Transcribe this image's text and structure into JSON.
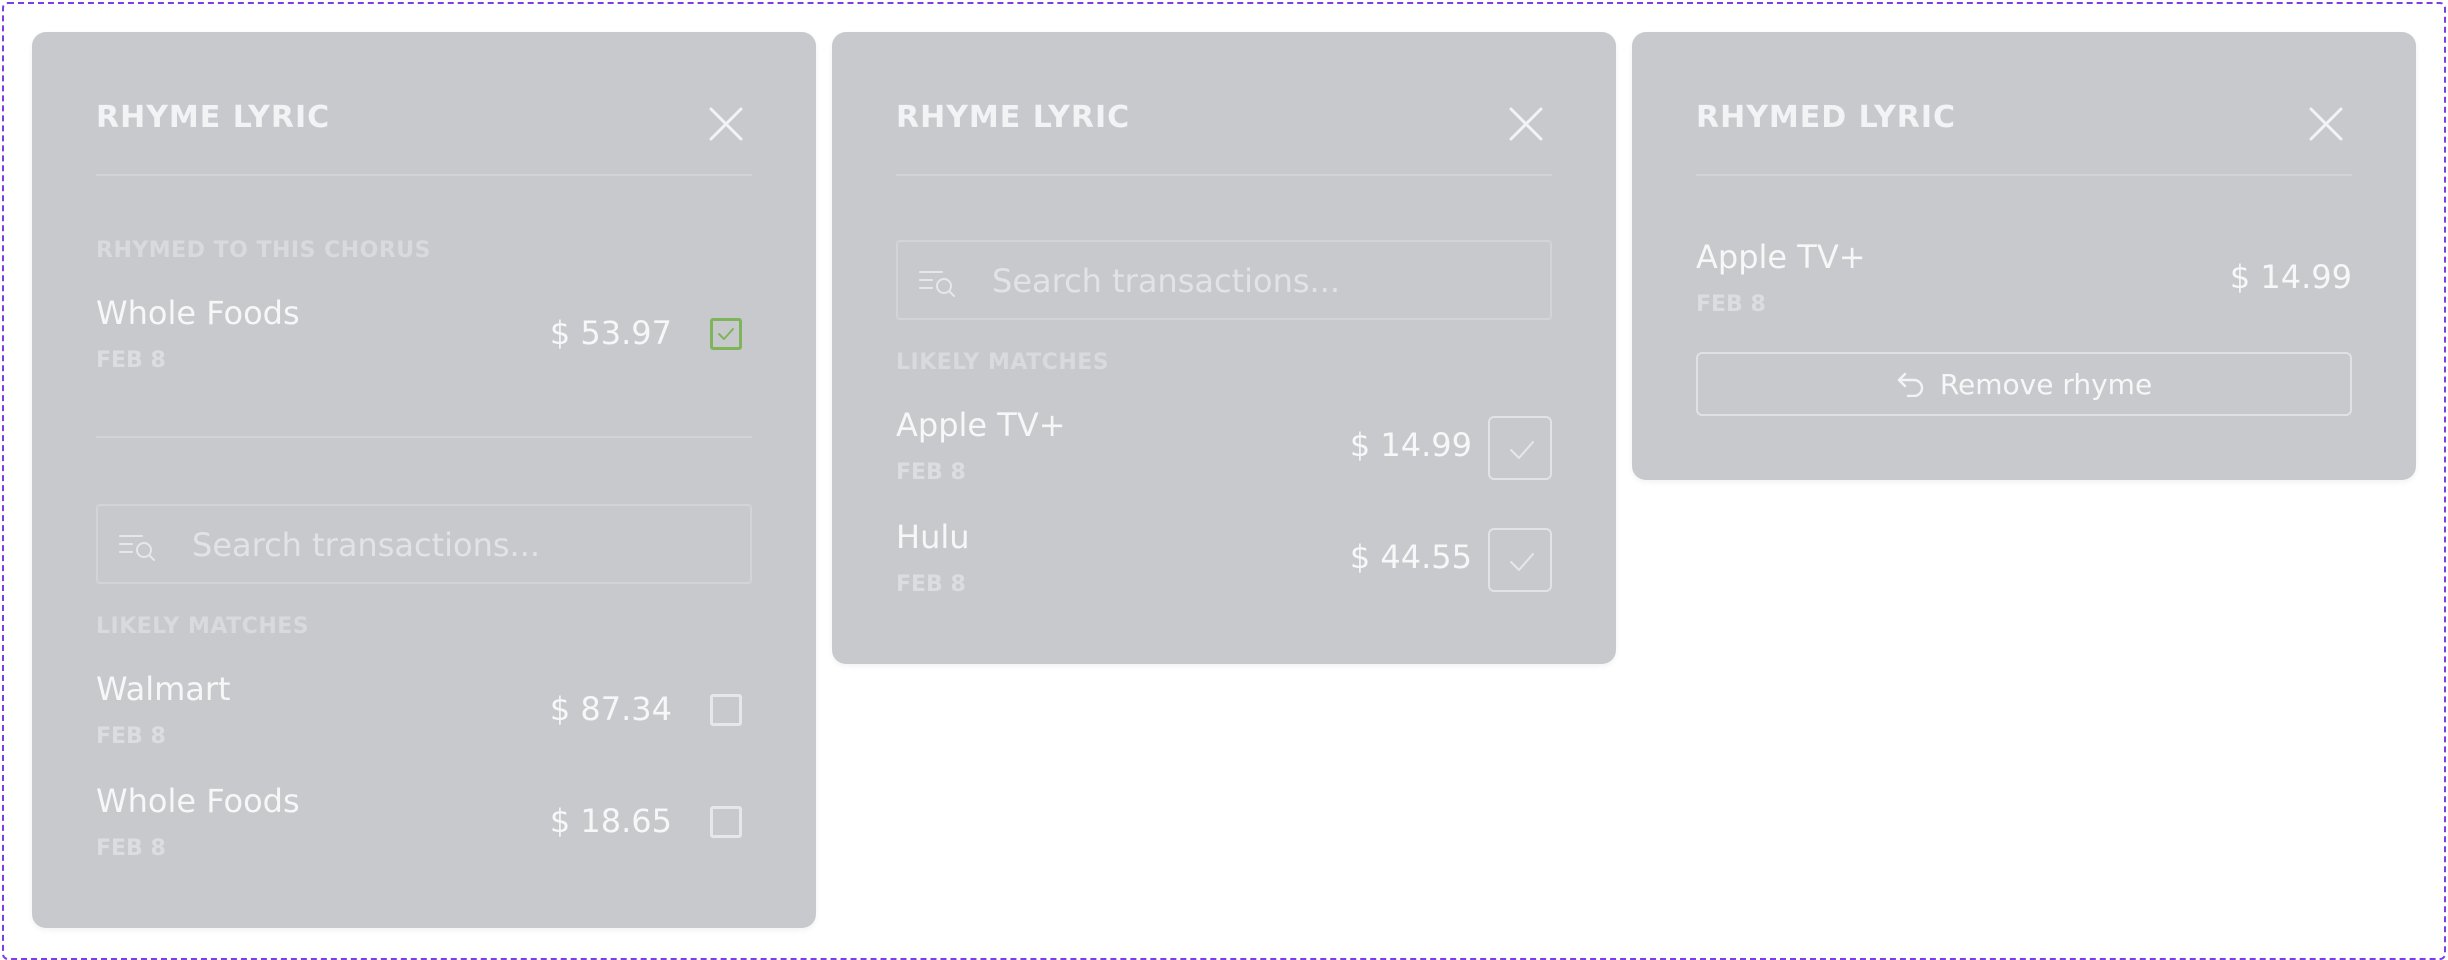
{
  "panel_1": {
    "title": "RHYME LYRIC",
    "section_label": "RHYMED TO THIS CHORUS",
    "rhymed": {
      "name": "Whole Foods",
      "date": "FEB 8",
      "amount": "$ 53.97",
      "checked": true
    },
    "search": {
      "placeholder": "Search transactions..."
    },
    "matches_label": "LIKELY MATCHES",
    "matches": [
      {
        "name": "Walmart",
        "date": "FEB 8",
        "amount": "$ 87.34",
        "checked": false
      },
      {
        "name": "Whole Foods",
        "date": "FEB 8",
        "amount": "$ 18.65",
        "checked": false
      }
    ]
  },
  "panel_2": {
    "title": "RHYME LYRIC",
    "search": {
      "placeholder": "Search transactions..."
    },
    "matches_label": "LIKELY MATCHES",
    "matches": [
      {
        "name": "Apple TV+",
        "date": "FEB 8",
        "amount": "$ 14.99"
      },
      {
        "name": "Hulu",
        "date": "FEB 8",
        "amount": "$ 44.55"
      }
    ]
  },
  "panel_3": {
    "title": "RHYMED LYRIC",
    "item": {
      "name": "Apple TV+",
      "date": "FEB 8",
      "amount": "$ 14.99"
    },
    "remove_button_label": "Remove rhyme"
  },
  "icons": {
    "close": "close-icon",
    "filter_search": "filter-search-icon",
    "check": "check-icon",
    "undo": "undo-arrow-icon"
  },
  "colors": {
    "panel_bg": "#c8c9cd",
    "checked_accent": "#7fb55a",
    "frame_border": "#7b3fe4"
  }
}
